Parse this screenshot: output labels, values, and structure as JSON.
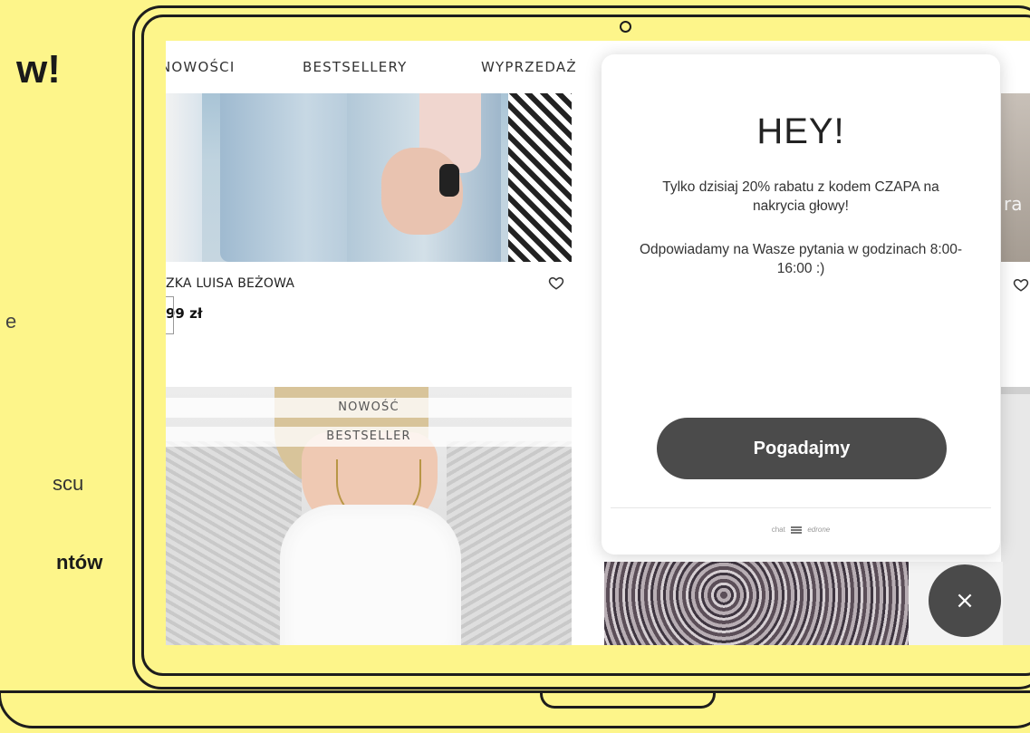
{
  "left_page": {
    "title_fragment": "w!",
    "text_fragment_1": "e",
    "text_fragment_2": "scu",
    "text_fragment_3": "ntów"
  },
  "nav": {
    "items": [
      "NOWOŚCI",
      "BESTSELLERY",
      "WYPRZEDAŻ"
    ]
  },
  "products": [
    {
      "name": "ZKA LUISA BEŻOWA",
      "price": "99 zł"
    },
    {
      "badges": [
        "NOWOŚĆ",
        "BESTSELLER"
      ]
    },
    {
      "partial_text": "ra"
    }
  ],
  "popup": {
    "title": "HEY!",
    "message_1": "Tylko dzisiaj 20% rabatu z kodem CZAPA na nakrycia głowy!",
    "message_2": "Odpowiadamy na Wasze pytania w godzinach 8:00-16:00 :)",
    "button_label": "Pogadajmy",
    "footer_chat": "chat",
    "footer_brand": "edrone"
  },
  "close_button": {
    "label": "×"
  },
  "colors": {
    "background": "#fdf58a",
    "button": "#4b4b4b"
  }
}
